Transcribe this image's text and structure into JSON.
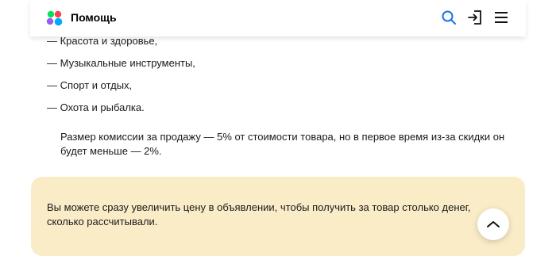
{
  "header": {
    "brand": "Помощь",
    "icons": [
      "search-icon",
      "login-icon",
      "menu-icon"
    ],
    "accent_color": "#1a73e8"
  },
  "list": {
    "items": [
      "— Красота и здоровье,",
      "— Музыкальные инструменты,",
      "— Спорт и отдых,",
      "— Охота и рыбалка."
    ]
  },
  "note": "Размер комиссии за продажу — 5% от стоимости товара, но в первое время из-за скидки он будет меньше — 2%.",
  "callout": {
    "text": "Вы можете сразу увеличить цену в объявлении, чтобы получить за товар столько денег, сколько рассчитывали.",
    "background": "#fbecc8"
  },
  "scroll_top_icon": "chevron-up-icon"
}
